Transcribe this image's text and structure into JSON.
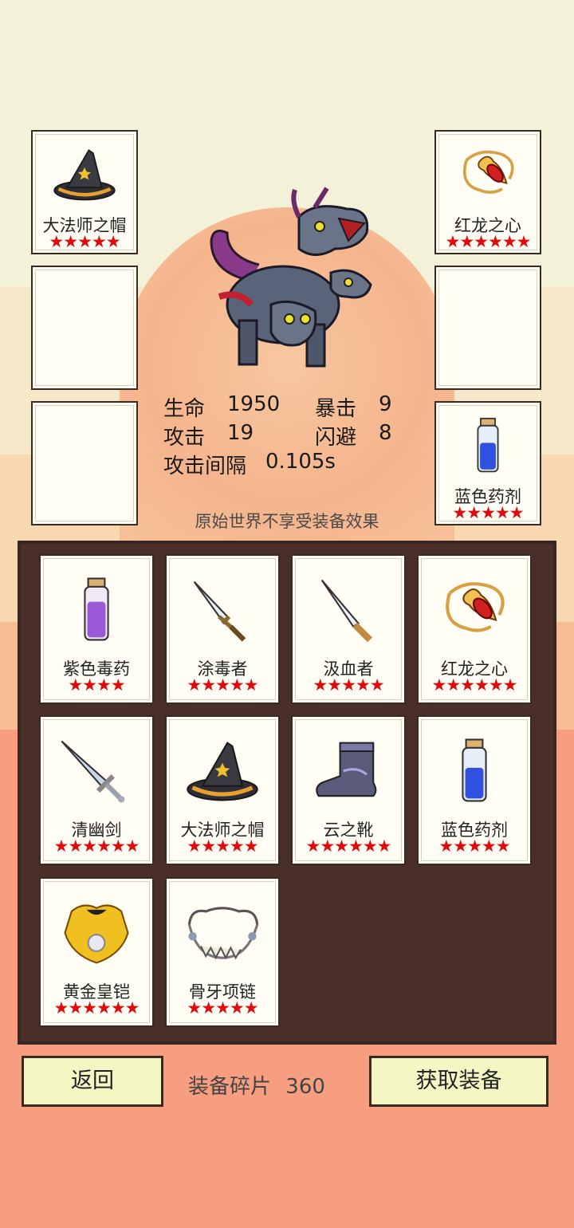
{
  "equipped": {
    "left": [
      {
        "name": "大法师之帽",
        "stars": "★★★★★",
        "icon": "wizard-hat-icon"
      },
      {
        "name": "",
        "stars": "",
        "icon": ""
      },
      {
        "name": "",
        "stars": "",
        "icon": ""
      }
    ],
    "right": [
      {
        "name": "红龙之心",
        "stars": "★★★★★★",
        "icon": "amulet-icon"
      },
      {
        "name": "",
        "stars": "",
        "icon": ""
      },
      {
        "name": "蓝色药剂",
        "stars": "★★★★★",
        "icon": "blue-potion-icon"
      }
    ]
  },
  "character": {
    "icon": "three-headed-dragon-icon"
  },
  "stats": {
    "hp_label": "生命",
    "hp_value": "1950",
    "crit_label": "暴击",
    "crit_value": "9",
    "atk_label": "攻击",
    "atk_value": "19",
    "dodge_label": "闪避",
    "dodge_value": "8",
    "interval_label": "攻击间隔",
    "interval_value": "0.105s"
  },
  "note": "原始世界不享受装备效果",
  "inventory": [
    {
      "name": "紫色毒药",
      "stars": "★★★★",
      "icon": "purple-potion-icon"
    },
    {
      "name": "涂毒者",
      "stars": "★★★★★",
      "icon": "dagger-icon"
    },
    {
      "name": "汲血者",
      "stars": "★★★★★",
      "icon": "knife-icon"
    },
    {
      "name": "红龙之心",
      "stars": "★★★★★★",
      "icon": "amulet-icon"
    },
    {
      "name": "清幽剑",
      "stars": "★★★★★★",
      "icon": "sword-icon"
    },
    {
      "name": "大法师之帽",
      "stars": "★★★★★",
      "icon": "wizard-hat-icon"
    },
    {
      "name": "云之靴",
      "stars": "★★★★★★",
      "icon": "boots-icon"
    },
    {
      "name": "蓝色药剂",
      "stars": "★★★★★",
      "icon": "blue-potion-icon"
    },
    {
      "name": "黄金皇铠",
      "stars": "★★★★★★",
      "icon": "gold-armor-icon"
    },
    {
      "name": "骨牙项链",
      "stars": "★★★★★",
      "icon": "bone-necklace-icon"
    }
  ],
  "footer": {
    "back_label": "返回",
    "shards_label": "装备碎片",
    "shards_value": "360",
    "get_label": "获取装备"
  },
  "colors": {
    "star": "#e00a0a",
    "panel": "#4a2f29",
    "button": "#f4f6c4"
  }
}
